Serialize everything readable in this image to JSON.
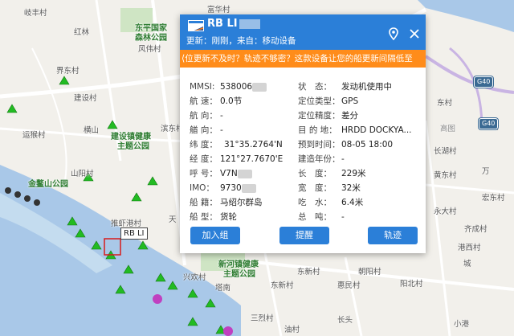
{
  "map": {
    "labels": {
      "qifeng": "岐丰村",
      "fuhua": "富华村",
      "honglin": "红林",
      "dongpingguojia": "东平国家",
      "senlingongyuan": "森林公园",
      "fengwei": "风伟村",
      "jiedong": "界东村",
      "jianshe": "建设村",
      "yunkai": "运猴村",
      "hengshan": "横山",
      "bindong": "滨东村",
      "jianshe_zhen": "建设镇健康",
      "zhuti": "主题公园",
      "shanyang": "山阳村",
      "jinaoshan": "金鳌山公园",
      "tuixin": "推虾港村",
      "xinhe": "新河镇健康",
      "xinhe2": "主题公园",
      "xingcun": "兴欢村",
      "talan": "塔南",
      "dongxin": "东新村",
      "dongxin2": "东新村",
      "huimin": "惠民村",
      "yangbei": "阳北村",
      "chaoyang": "朝阳村",
      "cheng": "城",
      "gangxi": "港西村",
      "qicheng": "齐成村",
      "huangdong": "黄东村",
      "yuanda": "永大村",
      "sanlu": "三烈村",
      "youshe": "油村",
      "xiaogang": "小港",
      "changtou": "长头",
      "hongdong": "宏东村",
      "gaotu": "高图",
      "zhanbei": "长湖村",
      "tiao": "天",
      "dong_": "东村",
      "xin": "新",
      "wan": "万"
    },
    "shields": [
      "G40",
      "G40"
    ],
    "ship_callout": "RB LI"
  },
  "popup": {
    "ship_name": "RB LI",
    "update_text": "更新：刚刚，来自：移动设备",
    "notice": "位更新不及时？轨迹不够密？这款设备让您的船更新间隔低至",
    "fields_left": [
      {
        "label": "MMSI:",
        "value": "538006"
      },
      {
        "label": "航 速：",
        "value": "0.0节"
      },
      {
        "label": "航 向：",
        "value": "-"
      },
      {
        "label": "艏 向：",
        "value": "-"
      },
      {
        "label": "纬 度：",
        "value": "31°35.2764'N"
      },
      {
        "label": "经 度：",
        "value": "121°27.7670'E"
      },
      {
        "label": "呼 号：",
        "value": "V7N"
      },
      {
        "label": "IMO：",
        "value": "9730"
      },
      {
        "label": "船 籍：",
        "value": "马绍尔群岛"
      },
      {
        "label": "船 型：",
        "value": "货轮"
      }
    ],
    "fields_right": [
      {
        "label": "状　态：",
        "value": "发动机使用中"
      },
      {
        "label": "定位类型：",
        "value": "GPS"
      },
      {
        "label": "定位精度：",
        "value": "差分"
      },
      {
        "label": "目 的 地：",
        "value": "HRDD DOCKYA..."
      },
      {
        "label": "预到时间：",
        "value": "08-05 18:00"
      },
      {
        "label": "建造年份：",
        "value": "-"
      },
      {
        "label": "长　度：",
        "value": "229米"
      },
      {
        "label": "宽　度：",
        "value": "32米"
      },
      {
        "label": "吃　水：",
        "value": "6.4米"
      },
      {
        "label": "总　吨：",
        "value": "-"
      }
    ],
    "buttons": {
      "add_group": "加入组",
      "remind": "提醒",
      "track": "轨迹"
    }
  },
  "colors": {
    "header": "#2b7fd8",
    "notice": "#ff8c1a",
    "river": "#a9c8e8"
  }
}
